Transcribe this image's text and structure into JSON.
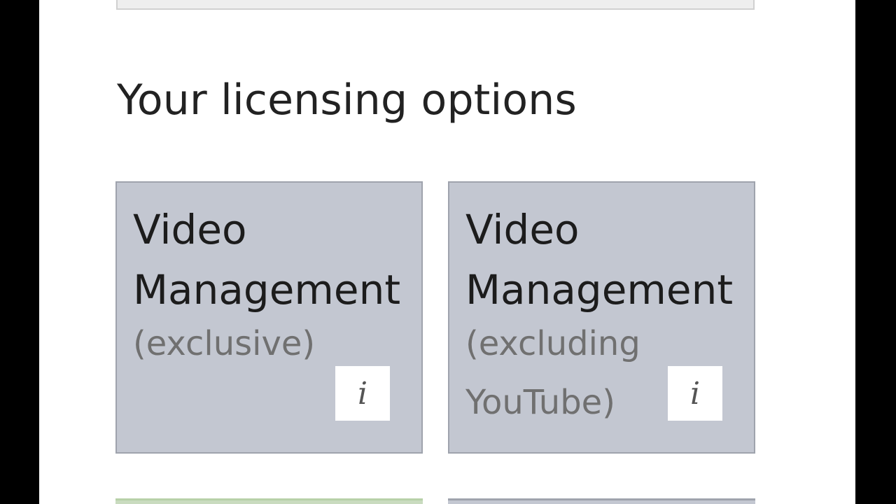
{
  "section": {
    "title": "Your licensing options"
  },
  "options": [
    {
      "title_line1": "Video",
      "title_line2": "Management",
      "subtitle": "(exclusive)",
      "info_label": "i"
    },
    {
      "title_line1": "Video",
      "title_line2": "Management",
      "subtitle": "(excluding YouTube)",
      "info_label": "i"
    }
  ],
  "colors": {
    "card_background": "#c3c7d1",
    "card_border": "#9fa3ad",
    "highlight_card_background": "#c9dbbf",
    "page_background": "#ffffff",
    "outer_background": "#000000"
  }
}
